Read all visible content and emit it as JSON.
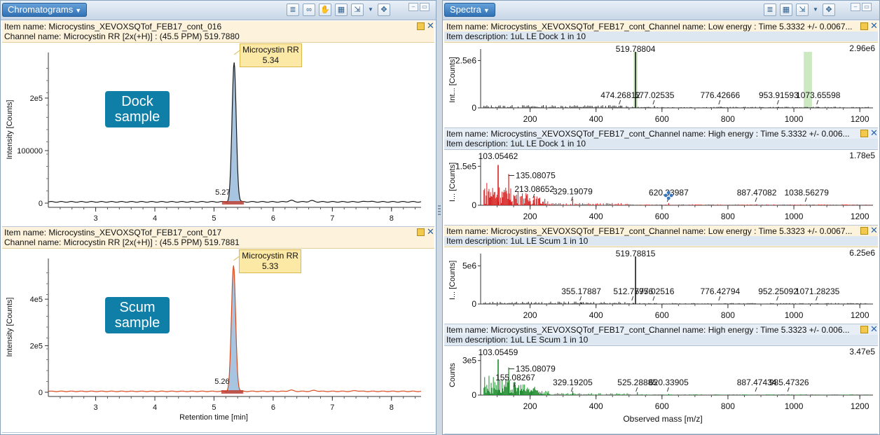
{
  "left_pane": {
    "title": "Chromatograms",
    "toolbar_icons": [
      "list-icon",
      "link-icon",
      "hand-icon",
      "table-icon",
      "export-icon",
      "move-icon"
    ]
  },
  "right_pane": {
    "title": "Spectra",
    "toolbar_icons": [
      "list-icon",
      "table-icon",
      "export-icon",
      "move-icon"
    ]
  },
  "chromatograms": [
    {
      "item_name": "Item name: Microcystins_XEVOXSQTof_FEB17_cont_016",
      "channel": "Channel name: Microcystin RR [2x(+H)] : (45.5 PPM) 519.7880",
      "callout_line1": "Dock",
      "callout_line2": "sample",
      "peak_name": "Microcystin RR",
      "peak_rt": "5.34",
      "small_peak": "5.27",
      "ylabel": "Intensity [Counts]",
      "xlabel": "",
      "color": "#1a1a1a",
      "fill": "#a7c4e0",
      "chart_data": {
        "type": "line",
        "x_ticks": [
          "3",
          "4",
          "5",
          "6",
          "7",
          "8"
        ],
        "y_ticks": [
          "0",
          "100000",
          "2e5"
        ],
        "y_tick_values": [
          0,
          100000,
          200000
        ],
        "xlim": [
          2.2,
          8.5
        ],
        "ylim": [
          0,
          280000
        ],
        "peak": {
          "x": 5.34,
          "y": 265000,
          "width": 0.05
        },
        "baseline": 2500,
        "bumps": [
          [
            6.3,
            2500
          ],
          [
            6.65,
            2000
          ],
          [
            7.6,
            1200
          ]
        ]
      }
    },
    {
      "item_name": "Item name: Microcystins_XEVOXSQTof_FEB17_cont_017",
      "channel": "Channel name: Microcystin RR [2x(+H)] : (45.5 PPM) 519.7881",
      "callout_line1": "Scum",
      "callout_line2": "sample",
      "peak_name": "Microcystin RR",
      "peak_rt": "5.33",
      "small_peak": "5.26",
      "ylabel": "Intensity [Counts]",
      "xlabel": "Retention time [min]",
      "color": "#d84a1e",
      "fill": "#a7c4e0",
      "chart_data": {
        "type": "line",
        "x_ticks": [
          "3",
          "4",
          "5",
          "6",
          "7",
          "8"
        ],
        "y_ticks": [
          "0",
          "2e5",
          "4e5"
        ],
        "y_tick_values": [
          0,
          200000,
          400000
        ],
        "xlim": [
          2.2,
          8.5
        ],
        "ylim": [
          0,
          560000
        ],
        "peak": {
          "x": 5.33,
          "y": 540000,
          "width": 0.05
        },
        "baseline": 4000,
        "bumps": [
          [
            6.3,
            5000
          ],
          [
            6.7,
            4000
          ],
          [
            7.4,
            3000
          ]
        ]
      }
    }
  ],
  "spectra": [
    {
      "item_name": "Item name: Microcystins_XEVOXSQTof_FEB17_cont_...",
      "channel": "Channel name: Low energy : Time 5.3332 +/- 0.0067...",
      "description": "Item description: 1uL LE Dock 1 in 10",
      "max": "2.96e6",
      "ylabel": "Int... [Counts]",
      "color": "#1a1a1a",
      "header_style": "yellow",
      "chart_data": {
        "type": "bar",
        "x_ticks": [
          "200",
          "400",
          "600",
          "800",
          "1000",
          "1200"
        ],
        "xlim": [
          50,
          1240
        ],
        "ylim": [
          0,
          2.96
        ],
        "y_ticks": [
          "0",
          "2.5e6"
        ],
        "y_tick_values": [
          0,
          2.5
        ],
        "labels": [
          {
            "mz": 519.78804,
            "text": "519.78804",
            "h": 2.96,
            "top": true
          },
          {
            "mz": 474.26812,
            "text": "474.26812",
            "h": 0.12
          },
          {
            "mz": 577.02535,
            "text": "577.02535",
            "h": 0.1
          },
          {
            "mz": 776.42666,
            "text": "776.42666",
            "h": 0.06
          },
          {
            "mz": 953.91593,
            "text": "953.91593",
            "h": 0.05
          },
          {
            "mz": 1073.65598,
            "text": "1073.65598",
            "h": 0.06
          }
        ],
        "highlight": [
          [
            514,
            526
          ],
          [
            1030,
            1055
          ]
        ]
      }
    },
    {
      "item_name": "Item name: Microcystins_XEVOXSQTof_FEB17_cont_...",
      "channel": "Channel name: High energy : Time 5.3332 +/- 0.006...",
      "description": "Item description: 1uL LE Dock 1 in 10",
      "max": "1.78e5",
      "ylabel": "I... [Counts]",
      "color": "#d62020",
      "header_style": "blue",
      "chart_data": {
        "type": "bar",
        "x_ticks": [
          "200",
          "400",
          "600",
          "800",
          "1000",
          "1200"
        ],
        "xlim": [
          50,
          1240
        ],
        "ylim": [
          0,
          1.78
        ],
        "y_ticks": [
          "0",
          "1.5e5"
        ],
        "y_tick_values": [
          0,
          1.5
        ],
        "labels": [
          {
            "mz": 103.05462,
            "text": "103.05462",
            "h": 1.55,
            "top": true
          },
          {
            "mz": 135.08075,
            "text": "135.08075",
            "h": 1.2,
            "dash": true
          },
          {
            "mz": 213.08652,
            "text": "213.08652",
            "h": 0.35
          },
          {
            "mz": 329.19079,
            "text": "329.19079",
            "h": 0.25
          },
          {
            "mz": 620.33987,
            "text": "620.33987",
            "h": 0.08
          },
          {
            "mz": 887.47082,
            "text": "887.47082",
            "h": 0.04
          },
          {
            "mz": 1038.56279,
            "text": "1038.56279",
            "h": 0.03
          }
        ],
        "cluster": [
          60,
          260
        ],
        "has_loader": true
      }
    },
    {
      "item_name": "Item name: Microcystins_XEVOXSQTof_FEB17_cont_...",
      "channel": "Channel name: Low energy : Time 5.3323 +/- 0.0067...",
      "description": "Item description: 1uL LE Scum 1 in 10",
      "max": "6.25e6",
      "ylabel": "I... [Counts]",
      "color": "#1a1a1a",
      "header_style": "yellow",
      "chart_data": {
        "type": "bar",
        "x_ticks": [
          "200",
          "400",
          "600",
          "800",
          "1000",
          "1200"
        ],
        "xlim": [
          50,
          1240
        ],
        "ylim": [
          0,
          6.25
        ],
        "y_ticks": [
          "0",
          "5e6"
        ],
        "y_tick_values": [
          0,
          5
        ],
        "labels": [
          {
            "mz": 519.78815,
            "text": "519.78815",
            "h": 6.25,
            "top": true
          },
          {
            "mz": 355.17887,
            "text": "355.17887",
            "h": 0.12
          },
          {
            "mz": 512.77956,
            "text": "512.77956",
            "h": 0.15
          },
          {
            "mz": 577.02516,
            "text": "577.02516",
            "h": 0.1
          },
          {
            "mz": 776.42794,
            "text": "776.42794",
            "h": 0.06
          },
          {
            "mz": 952.25092,
            "text": "952.25092",
            "h": 0.05
          },
          {
            "mz": 1071.28235,
            "text": "1071.28235",
            "h": 0.06
          }
        ]
      }
    },
    {
      "item_name": "Item name: Microcystins_XEVOXSQTof_FEB17_cont_...",
      "channel": "Channel name: High energy : Time 5.3323 +/- 0.006...",
      "description": "Item description: 1uL LE Scum 1 in 10",
      "max": "3.47e5",
      "ylabel": "Counts",
      "xlabel": "Observed mass [m/z]",
      "color": "#1a8a2a",
      "header_style": "blue",
      "chart_data": {
        "type": "bar",
        "x_ticks": [
          "200",
          "400",
          "600",
          "800",
          "1000",
          "1200"
        ],
        "xlim": [
          50,
          1240
        ],
        "ylim": [
          0,
          3.47
        ],
        "y_ticks": [
          "0",
          "3e5"
        ],
        "y_tick_values": [
          0,
          3
        ],
        "labels": [
          {
            "mz": 103.05459,
            "text": "103.05459",
            "h": 3.1,
            "top": true
          },
          {
            "mz": 135.08079,
            "text": "135.08079",
            "h": 2.4,
            "dash": true
          },
          {
            "mz": 155.08267,
            "text": "155.08267",
            "h": 0.9
          },
          {
            "mz": 329.19205,
            "text": "329.19205",
            "h": 0.35
          },
          {
            "mz": 525.28885,
            "text": "525.28885",
            "h": 0.25
          },
          {
            "mz": 620.33905,
            "text": "620.33905",
            "h": 0.1
          },
          {
            "mz": 887.47434,
            "text": "887.47434",
            "h": 0.05
          },
          {
            "mz": 985.47326,
            "text": "985.47326",
            "h": 0.06
          }
        ],
        "cluster": [
          60,
          260
        ]
      }
    }
  ]
}
